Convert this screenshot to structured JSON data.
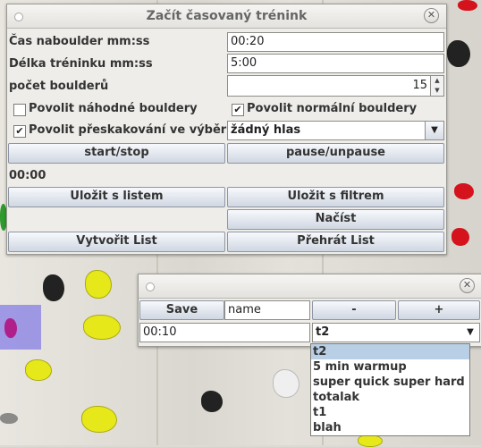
{
  "main_window": {
    "title": "Začít časovaný trénink",
    "close_glyph": "✕",
    "labels": {
      "hang_time": "Čas naboulder  mm:ss",
      "training_length": "Délka tréninku mm:ss",
      "boulder_count": "počet boulderů"
    },
    "values": {
      "hang_time": "00:20",
      "training_length": "5:00",
      "boulder_count": "15"
    },
    "checkboxes": {
      "random": {
        "label": "Povolit náhodné bouldery",
        "checked": false
      },
      "normal": {
        "label": "Povolit normální bouldery",
        "checked": true
      },
      "skip": {
        "label": "Povolit přeskakování ve výběru",
        "checked": true
      }
    },
    "voice_select": {
      "value": "žádný hlas",
      "arrow_icon": "chevron-down-icon"
    },
    "buttons": {
      "start_stop": "start/stop",
      "pause": "pause/unpause",
      "save_list": "Uložit s listem",
      "save_filter": "Uložit s filtrem",
      "load": "Načíst",
      "create_list": "Vytvořit List",
      "play_list": "Přehrát List"
    },
    "timer_display": "00:00"
  },
  "list_window": {
    "close_glyph": "✕",
    "save_button": "Save",
    "name_input": "name",
    "minus_button": "-",
    "plus_button": "+",
    "time_input": "00:10",
    "list_select": {
      "value": "t2",
      "options": [
        "t2",
        "5 min warmup",
        "super quick super hard",
        "totalak",
        "t1",
        "blah"
      ],
      "selected_index": 0
    }
  },
  "colors": {
    "button_gradient_top": "#f7f9fc",
    "button_gradient_bottom": "#d0d7e2",
    "selected_option": "#b8cfe5"
  }
}
